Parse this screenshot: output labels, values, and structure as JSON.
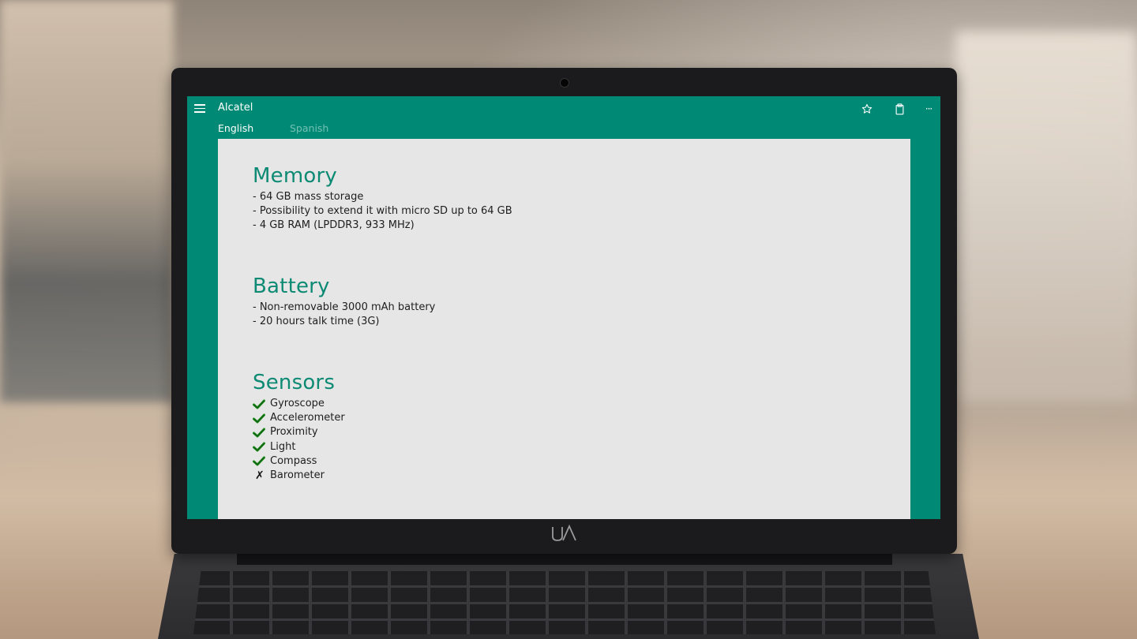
{
  "app": {
    "title": "Alcatel",
    "tabs": [
      {
        "label": "English",
        "active": true
      },
      {
        "label": "Spanish",
        "active": false
      }
    ],
    "accent_color": "#008a76",
    "heading_color": "#0d8a74"
  },
  "toolbar": {
    "icons": [
      "star-icon",
      "clipboard-icon",
      "more-icon"
    ],
    "more_label": "···"
  },
  "memory": {
    "heading": "Memory",
    "items": [
      "- 64 GB mass storage",
      "- Possibility to extend it with micro SD up to 64 GB",
      "- 4 GB RAM (LPDDR3, 933 MHz)"
    ]
  },
  "battery": {
    "heading": "Battery",
    "items": [
      "- Non-removable 3000 mAh battery",
      "- 20 hours talk time (3G)"
    ]
  },
  "sensors": {
    "heading": "Sensors",
    "items": [
      {
        "name": "Gyroscope",
        "supported": true
      },
      {
        "name": "Accelerometer",
        "supported": true
      },
      {
        "name": "Proximity",
        "supported": true
      },
      {
        "name": "Light",
        "supported": true
      },
      {
        "name": "Compass",
        "supported": true
      },
      {
        "name": "Barometer",
        "supported": false
      }
    ],
    "check_color": "#1a8c1a",
    "cross_mark": "✗"
  }
}
